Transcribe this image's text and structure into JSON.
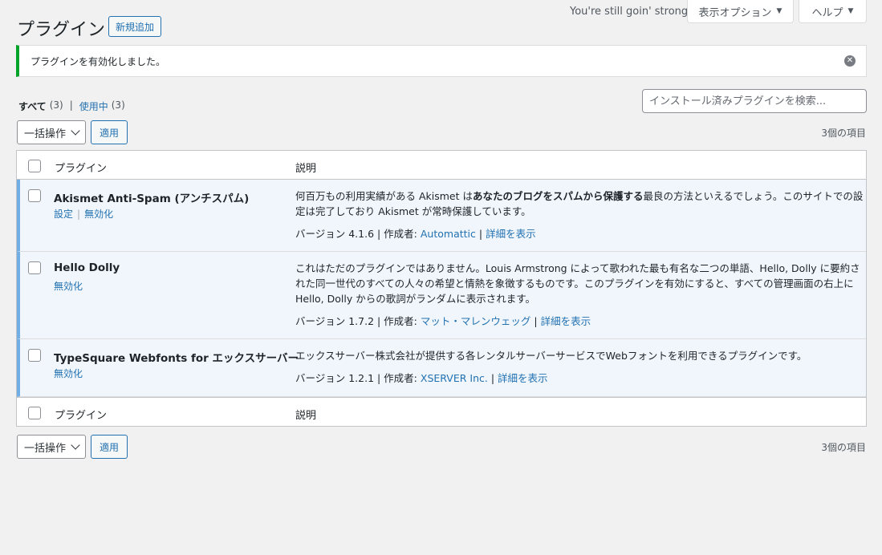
{
  "screen_meta": {
    "lyric": "You're still goin' strong",
    "screen_options_label": "表示オプション",
    "help_label": "ヘルプ"
  },
  "header": {
    "title": "プラグイン",
    "add_new_label": "新規追加"
  },
  "notice": {
    "message": "プラグインを有効化しました。"
  },
  "filters": {
    "all_label": "すべて",
    "all_count": "(3)",
    "separator": "|",
    "active_label": "使用中",
    "active_count": "(3)"
  },
  "search": {
    "placeholder": "インストール済みプラグインを検索..."
  },
  "tablenav": {
    "bulk_label": "一括操作",
    "apply_label": "適用",
    "count_label": "3個の項目"
  },
  "table": {
    "col_plugin": "プラグイン",
    "col_description": "説明",
    "rows": [
      {
        "name": "Akismet Anti-Spam (アンチスパム)",
        "actions": [
          "設定",
          "無効化"
        ],
        "desc_before": "何百万もの利用実績がある Akismet は",
        "desc_bold": "あなたのブログをスパムから保護する",
        "desc_after": "最良の方法といえるでしょう。このサイトでの設定は完了しており Akismet が常時保護しています。",
        "version_text": "バージョン 4.1.6 | 作成者: ",
        "author": "Automattic",
        "sep": " | ",
        "details": "詳細を表示"
      },
      {
        "name": "Hello Dolly",
        "actions": [
          "無効化"
        ],
        "desc_before": "これはただのプラグインではありません。Louis Armstrong によって歌われた最も有名な二つの単語、Hello, Dolly に要約された同一世代のすべての人々の希望と情熱を象徴するものです。このプラグインを有効にすると、すべての管理画面の右上に Hello, Dolly からの歌詞がランダムに表示されます。",
        "version_text": "バージョン 1.7.2 | 作成者: ",
        "author": "マット・マレンウェッグ",
        "sep": " | ",
        "details": "詳細を表示"
      },
      {
        "name": "TypeSquare Webfonts for エックスサーバー",
        "actions": [
          "無効化"
        ],
        "desc_before": "エックスサーバー株式会社が提供する各レンタルサーバーサービスでWebフォントを利用できるプラグインです。",
        "version_text": "バージョン 1.2.1 | 作成者: ",
        "author": "XSERVER Inc.",
        "sep": " | ",
        "details": "詳細を表示"
      }
    ]
  }
}
